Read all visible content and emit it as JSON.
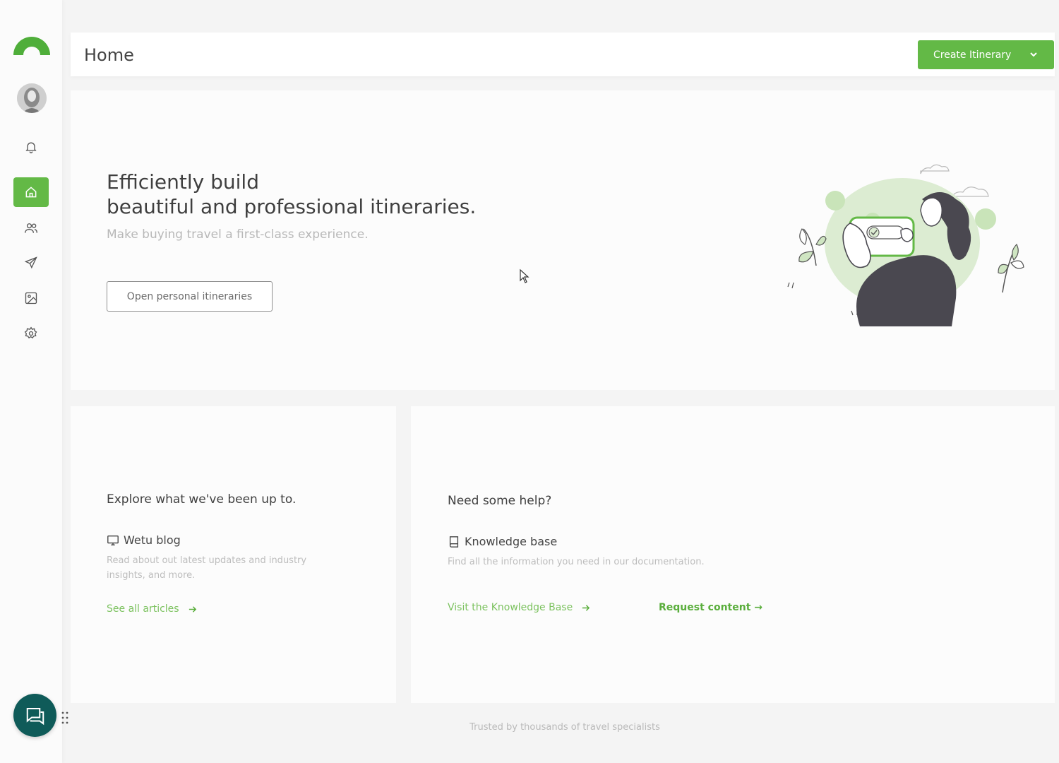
{
  "header": {
    "title": "Home",
    "create_button": "Create Itinerary"
  },
  "sidebar": {
    "items": [
      {
        "name": "notifications",
        "icon": "bell-icon"
      },
      {
        "name": "home",
        "icon": "home-icon",
        "active": true
      },
      {
        "name": "contacts",
        "icon": "users-icon"
      },
      {
        "name": "send",
        "icon": "send-icon"
      },
      {
        "name": "media",
        "icon": "image-icon"
      },
      {
        "name": "settings",
        "icon": "gear-icon"
      }
    ]
  },
  "hero": {
    "title_line1": "Efficiently build",
    "title_line2": "beautiful and professional itineraries.",
    "subtitle": "Make buying travel a first-class experience.",
    "button": "Open personal itineraries"
  },
  "explore": {
    "title": "Explore what we've been up to.",
    "resource_label": "Wetu blog",
    "description": "Read about out latest updates and industry insights, and more.",
    "link": "See all articles"
  },
  "help": {
    "title": "Need some help?",
    "resource_label": "Knowledge base",
    "description": "Find all the information you need in our documentation.",
    "link": "Visit the Knowledge Base",
    "secondary_link": "Request content →"
  },
  "footer": {
    "text": "Trusted by thousands of travel specialists"
  },
  "colors": {
    "accent": "#63b946",
    "chat": "#0f5b59",
    "link": "#7cc25f"
  }
}
